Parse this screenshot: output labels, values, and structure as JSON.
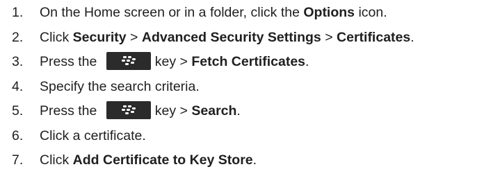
{
  "steps": [
    {
      "num": "1.",
      "parts": [
        "On the Home screen or in a folder, click the ",
        "Options",
        " icon."
      ]
    },
    {
      "num": "2.",
      "parts": [
        "Click ",
        "Security",
        " > ",
        "Advanced Security Settings",
        " > ",
        "Certificates",
        "."
      ]
    },
    {
      "num": "3.",
      "parts": [
        "Press the ",
        "key > ",
        "Fetch Certificates",
        "."
      ]
    },
    {
      "num": "4.",
      "parts": [
        "Specify the search criteria."
      ]
    },
    {
      "num": "5.",
      "parts": [
        "Press the ",
        "key > ",
        "Search",
        "."
      ]
    },
    {
      "num": "6.",
      "parts": [
        "Click a certificate."
      ]
    },
    {
      "num": "7.",
      "parts": [
        "Click ",
        "Add Certificate to Key Store",
        "."
      ]
    }
  ],
  "icons": {
    "menu_key": "blackberry-menu-key-icon"
  },
  "colors": {
    "text": "#1f1f1f",
    "key_background": "#2b2b2b",
    "key_logo": "#ffffff"
  }
}
